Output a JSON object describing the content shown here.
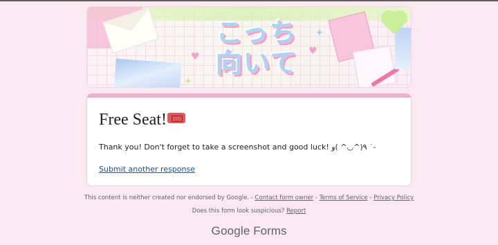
{
  "banner": {
    "art_text_line1": "こっち",
    "art_text_line2": "向いて"
  },
  "form": {
    "title": "Free Seat!",
    "title_emoji": "ticket-icon",
    "message": "Thank you! Don't forget to take a screenshot and good luck! ٩(^◡^ )و ˙-",
    "submit_another": "Submit another response"
  },
  "footer": {
    "disclaimer": "This content is neither created nor endorsed by Google.",
    "sep": " - ",
    "contact_owner": "Contact form owner",
    "terms": "Terms of Service",
    "privacy": "Privacy Policy",
    "suspicious_q": "Does this form look suspicious?",
    "report": "Report"
  },
  "brand": {
    "google": "Google",
    "forms": "Forms"
  },
  "colors": {
    "page_bg": "#fbe9f2",
    "accent": "#eab1cd",
    "link": "#1a4fa3"
  }
}
